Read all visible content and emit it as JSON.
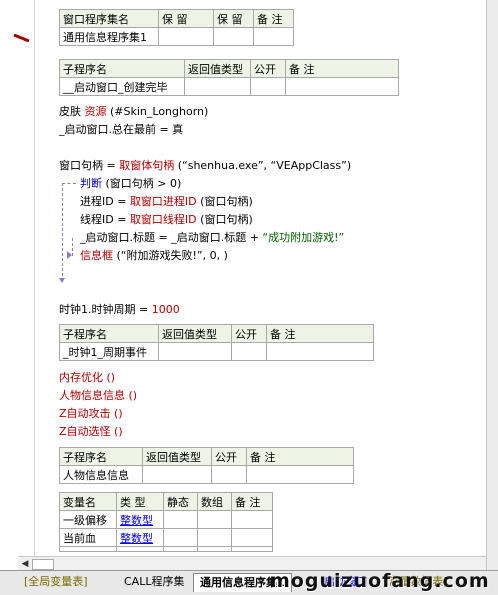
{
  "assembly_table": {
    "headers": [
      "窗口程序集名",
      "保 留",
      "保 留",
      "备 注"
    ],
    "row": [
      "通用信息程序集1",
      "",
      "",
      ""
    ]
  },
  "sub1_table": {
    "headers": [
      "子程序名",
      "返回值类型",
      "公开",
      "备 注"
    ],
    "row": [
      "__启动窗口_创建完毕",
      "",
      "",
      ""
    ]
  },
  "code1": {
    "line1_a": "皮肤",
    "line1_b": "资源",
    "line1_c": "(#Skin_Longhorn)",
    "line2": "_启动窗口.总在最前 = 真",
    "line3_a": "窗口句柄 = ",
    "line3_b": "取窗体句柄",
    "line3_c": "(“shenhua.exe”, “VEAppClass”)",
    "line4_a": "判断",
    "line4_b": "(窗口句柄 > 0)",
    "line5_a": "进程ID = ",
    "line5_b": "取窗口进程ID",
    "line5_c": "(窗口句柄)",
    "line6_a": "线程ID = ",
    "line6_b": "取窗口线程ID",
    "line6_c": "(窗口句柄)",
    "line7_a": "_启动窗口.标题 = _启动窗口.标题 + ",
    "line7_b": "“成功附加游戏!”",
    "line8_a": "信息框",
    "line8_b": "(“附加游戏失败!”, 0, )"
  },
  "code2": {
    "line_a": "时钟1.时钟周期 = ",
    "line_b": "1000"
  },
  "sub2_table": {
    "headers": [
      "子程序名",
      "返回值类型",
      "公开",
      "备 注"
    ],
    "row": [
      "_时钟1_周期事件",
      "",
      "",
      ""
    ]
  },
  "calls": [
    "内存优化 ()",
    "人物信息信息 ()",
    "Z自动攻击 ()",
    "Z自动选怪 ()"
  ],
  "sub3_table": {
    "headers": [
      "子程序名",
      "返回值类型",
      "公开",
      "备 注"
    ],
    "row": [
      "人物信息信息",
      "",
      "",
      ""
    ]
  },
  "var_table": {
    "headers": [
      "变量名",
      "类 型",
      "静态",
      "数组",
      "备 注"
    ],
    "rows": [
      [
        "一级偏移",
        "整数型",
        "",
        "",
        ""
      ],
      [
        "当前血",
        "整数型",
        "",
        "",
        ""
      ],
      [
        "",
        "",
        "",
        "",
        ""
      ]
    ]
  },
  "tabs": [
    "[全局变量表]",
    "CALL程序集",
    "通用信息程序集1",
    "启动窗口",
    "[常量数据表]"
  ],
  "watermark": "moguizuofang.com",
  "colors": {
    "keyword_red": "#b00000",
    "flow_blue": "#0000c8",
    "string_green": "#006000",
    "header_bg": "#eef3e6"
  }
}
